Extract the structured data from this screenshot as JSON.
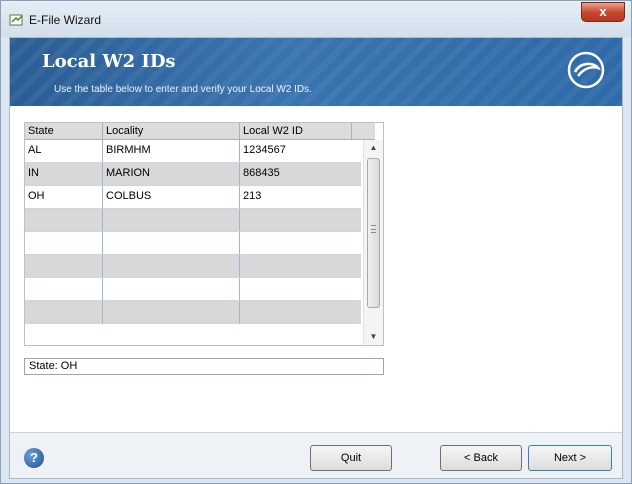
{
  "window": {
    "title": "E-File Wizard",
    "close_label": "x"
  },
  "banner": {
    "title": "Local W2 IDs",
    "subtitle": "Use the table below to enter and verify your Local W2 IDs.",
    "logo_icon": "swirl-logo-icon"
  },
  "table": {
    "columns": [
      "State",
      "Locality",
      "Local W2 ID"
    ],
    "rows": [
      [
        "AL",
        "BIRMHM",
        "1234567"
      ],
      [
        "IN",
        "MARION",
        "868435"
      ],
      [
        "OH",
        "COLBUS",
        "213"
      ],
      [
        "",
        "",
        ""
      ],
      [
        "",
        "",
        ""
      ],
      [
        "",
        "",
        ""
      ],
      [
        "",
        "",
        ""
      ],
      [
        "",
        "",
        ""
      ]
    ]
  },
  "status": {
    "text": "State: OH"
  },
  "footer": {
    "help_icon": "help-icon",
    "quit_label": "Quit",
    "back_label": "< Back",
    "next_label": "Next >"
  },
  "colors": {
    "banner": "#2e6aa8",
    "alt_row": "#d8d8d8",
    "close": "#c4452c"
  }
}
